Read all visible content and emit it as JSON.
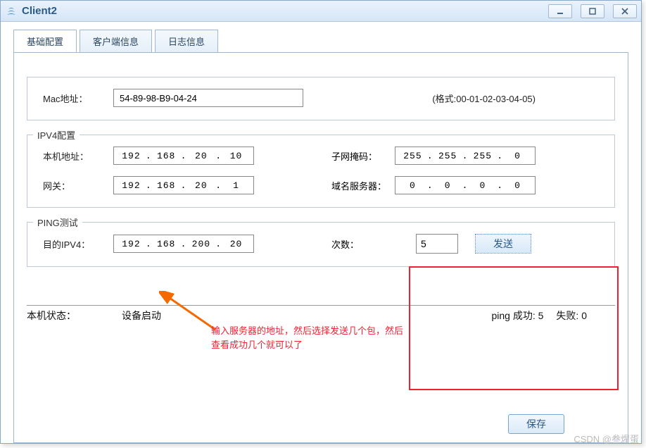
{
  "window": {
    "title": "Client2"
  },
  "tabs": [
    {
      "label": "基础配置",
      "active": true
    },
    {
      "label": "客户端信息",
      "active": false
    },
    {
      "label": "日志信息",
      "active": false
    }
  ],
  "mac": {
    "label": "Mac地址：",
    "value": "54-89-98-B9-04-24",
    "format_hint": "(格式:00-01-02-03-04-05)"
  },
  "ipv4": {
    "legend": "IPV4配置",
    "local_label": "本机地址：",
    "local_ip": {
      "a": "192",
      "b": "168",
      "c": "20",
      "d": "10"
    },
    "mask_label": "子网掩码：",
    "mask": {
      "a": "255",
      "b": "255",
      "c": "255",
      "d": "0"
    },
    "gateway_label": "网关：",
    "gateway": {
      "a": "192",
      "b": "168",
      "c": "20",
      "d": "1"
    },
    "dns_label": "域名服务器：",
    "dns": {
      "a": "0",
      "b": "0",
      "c": "0",
      "d": "0"
    }
  },
  "ping": {
    "legend": "PING测试",
    "target_label": "目的IPV4：",
    "target": {
      "a": "192",
      "b": "168",
      "c": "200",
      "d": "20"
    },
    "count_label": "次数：",
    "count": "5",
    "send_label": "发送"
  },
  "status": {
    "label": "本机状态：",
    "value": "设备启动",
    "ping_ok_label": "ping 成功:",
    "ping_ok": "5",
    "ping_fail_label": "失败:",
    "ping_fail": "0"
  },
  "save_label": "保存",
  "annotation": "输入服务器的地址，然后选择发送几个包，然后查看成功几个就可以了",
  "watermark": "CSDN @叁煋蛋"
}
